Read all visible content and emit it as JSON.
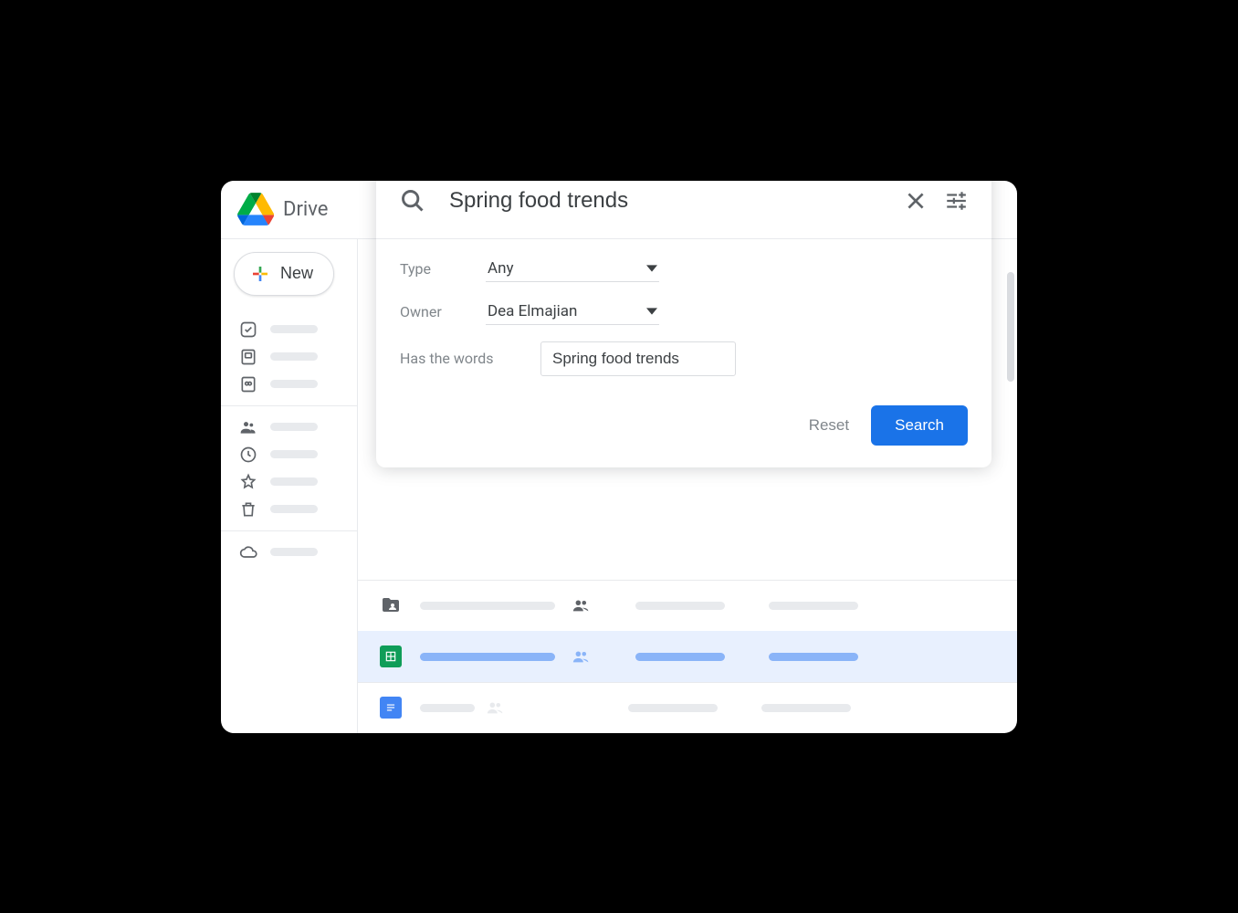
{
  "app": {
    "name": "Drive"
  },
  "sidebar": {
    "new_label": "New"
  },
  "search": {
    "query": "Spring food trends",
    "filters": {
      "type_label": "Type",
      "type_value": "Any",
      "owner_label": "Owner",
      "owner_value": "Dea Elmajian",
      "words_label": "Has the words",
      "words_value": "Spring food trends"
    },
    "reset_label": "Reset",
    "search_label": "Search"
  }
}
